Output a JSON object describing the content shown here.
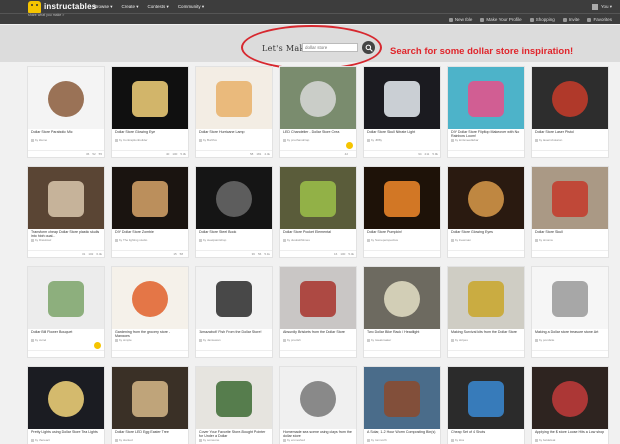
{
  "header": {
    "logo_text": "instructables",
    "tagline": "share what you make >",
    "nav": [
      "Browse ▾",
      "Create ▾",
      "Contests ▾",
      "Community ▾"
    ],
    "account_label": "You ▾",
    "subnav": [
      "New Ible",
      "Make Your Profile",
      "Shopping",
      "Invite",
      "Favorites"
    ]
  },
  "search": {
    "label": "Let's Make",
    "placeholder": "dollar store",
    "annotation": "Search for some dollar store inspiration!",
    "annotation_color": "#e0252b"
  },
  "grid": [
    {
      "title": "Dollar Store Parabolic Mic",
      "author": "by ldemo",
      "views": "36",
      "favs": "52",
      "comments": "55",
      "bg": "#f4f4f4",
      "fg": "#8a5a3a",
      "fav": false
    },
    {
      "title": "Dollar Store Glowing Eye",
      "author": "by Contraptionbuilder",
      "views": "40",
      "favs": "100",
      "comments": "5.3k",
      "bg": "#101010",
      "fg": "#f5d27a",
      "fav": false
    },
    {
      "title": "Dollar Store Hurricane Lamp",
      "author": "by Burlifox",
      "views": "58",
      "favs": "181",
      "comments": "4.4k",
      "bg": "#f3ede4",
      "fg": "#e8b06a",
      "fav": false
    },
    {
      "title": "LED Chandelier - Dollar Store Crea",
      "author": "by pnuthandcrap",
      "views": "42",
      "favs": "",
      "comments": "",
      "bg": "#7a8c6e",
      "fg": "#d8d8d8",
      "fav": true
    },
    {
      "title": "Dollar Store Skull Nitrate Light",
      "author": "by Jl88y",
      "views": "94",
      "favs": "211",
      "comments": "5.9k",
      "bg": "#1b1b20",
      "fg": "#e9eef5",
      "fav": false
    },
    {
      "title": "DIY Dollar Store Flipflop Makeover with No Rainbow Loom!",
      "author": "by knitsneedlebar",
      "views": "",
      "favs": "",
      "comments": "",
      "bg": "#4db3c9",
      "fg": "#e94f8a",
      "fav": false
    },
    {
      "title": "Dollar Store Laser Pistol",
      "author": "by laserrobotaron",
      "views": "",
      "favs": "",
      "comments": "",
      "bg": "#2d2d2d",
      "fg": "#c83c2a",
      "fav": false
    },
    {
      "title": "Transform cheap Dollar Store plastic skulls into high qual...",
      "author": "by Diavlotaz",
      "views": "31",
      "favs": "102",
      "comments": "6.4k",
      "bg": "#5a4534",
      "fg": "#d9c7ad",
      "fav": false
    },
    {
      "title": "DIY Dollar Store Zombie",
      "author": "by The lighting studio",
      "views": "15",
      "favs": "58",
      "comments": "",
      "bg": "#1a1410",
      "fg": "#d8a56a",
      "fav": false
    },
    {
      "title": "Dollar Store Steel Book",
      "author": "by steelpaintshop",
      "views": "36",
      "favs": "56",
      "comments": "5.1k",
      "bg": "#151515",
      "fg": "#6a6a6a",
      "fav": false
    },
    {
      "title": "Dollar Store Pocket Elemental",
      "author": "by duskwithtimes",
      "views": "16",
      "favs": "100",
      "comments": "5.4k",
      "bg": "#5a5c3a",
      "fg": "#9cc04a",
      "fav": false
    },
    {
      "title": "Dollar Store Pumpkin!",
      "author": "by Someperspective",
      "views": "",
      "favs": "",
      "comments": "",
      "bg": "#1e1208",
      "fg": "#f2892a",
      "fav": false
    },
    {
      "title": "Dollar Store Glowing Eyes",
      "author": "by lnewman",
      "views": "",
      "favs": "",
      "comments": "",
      "bg": "#2a1a10",
      "fg": "#d99b4a",
      "fav": false
    },
    {
      "title": "Dollar Store Skull",
      "author": "by sinoma",
      "views": "",
      "favs": "",
      "comments": "",
      "bg": "#aa9985",
      "fg": "#c43a2a",
      "fav": false
    },
    {
      "title": "Dollar Bill Flower Bouquet",
      "author": "by curiel",
      "views": "",
      "favs": "",
      "comments": "",
      "bg": "#ececec",
      "fg": "#7da46a",
      "fav": true
    },
    {
      "title": "Gardening from the grocery store - Mangoes",
      "author": "by simple",
      "views": "",
      "favs": "",
      "comments": "",
      "bg": "#f5f1ea",
      "fg": "#e0602a",
      "fav": false
    },
    {
      "title": "'Amazabolt' Fish From the Dollar Store!",
      "author": "by Jamiewan",
      "views": "",
      "favs": "",
      "comments": "",
      "bg": "#f2f2f2",
      "fg": "#2a2a2a",
      "fav": false
    },
    {
      "title": "Absurdly Briskets from the Dollar Store",
      "author": "by pnuttsh",
      "views": "",
      "favs": "",
      "comments": "",
      "bg": "#c9c6c5",
      "fg": "#a8322c",
      "fav": false
    },
    {
      "title": "Two Dollar Bike Rack / Headlight",
      "author": "by tweakmaker",
      "views": "",
      "favs": "",
      "comments": "",
      "bg": "#6d6a60",
      "fg": "#e4dfc6",
      "fav": false
    },
    {
      "title": "Making Survival kits from the Dollar Store",
      "author": "by stripes",
      "views": "",
      "favs": "",
      "comments": "",
      "bg": "#cfcdc4",
      "fg": "#c9a62a",
      "fav": false
    },
    {
      "title": "Making a Dollar store treasure stone Art",
      "author": "by pondsite",
      "views": "",
      "favs": "",
      "comments": "",
      "bg": "#f6f6f6",
      "fg": "#999",
      "fav": false
    },
    {
      "title": "Pretty Lights using Dollar Store Tea Lights",
      "author": "by thereact",
      "views": "",
      "favs": "",
      "comments": "",
      "bg": "#1b1c22",
      "fg": "#f5d67a",
      "fav": false
    },
    {
      "title": "Dollar Store LED Egg Easter Tree",
      "author": "by slanted",
      "views": "",
      "favs": "",
      "comments": "",
      "bg": "#3a3026",
      "fg": "#d7b98a",
      "fav": false
    },
    {
      "title": "Cover Your Favorite Store-Bought Pointer for Under a Dollar",
      "author": "by someone",
      "views": "",
      "favs": "",
      "comments": "",
      "bg": "#e6e4df",
      "fg": "#3c6b34",
      "fav": false
    },
    {
      "title": "Homemade sea scene using clays from the dollar store",
      "author": "by enmeshed",
      "views": "",
      "favs": "",
      "comments": "",
      "bg": "#f0f0f0",
      "fg": "#777",
      "fav": false
    },
    {
      "title": "A Solar, 1-2 Hour Worm Composting Bin(s)",
      "author": "by tomnorth",
      "views": "",
      "favs": "",
      "comments": "",
      "bg": "#4a6c8a",
      "fg": "#8c4a2c",
      "fav": false
    },
    {
      "title": "Cheap Set of 4 Shots",
      "author": "by kiss",
      "views": "",
      "favs": "",
      "comments": "",
      "bg": "#2b2b2b",
      "fg": "#3a8ad4",
      "fav": false
    },
    {
      "title": "Applying the $ store Loose Hits a Low shop",
      "author": "by beldefeat",
      "views": "",
      "favs": "",
      "comments": "",
      "bg": "#2e2420",
      "fg": "#c23b3b",
      "fav": false
    }
  ]
}
